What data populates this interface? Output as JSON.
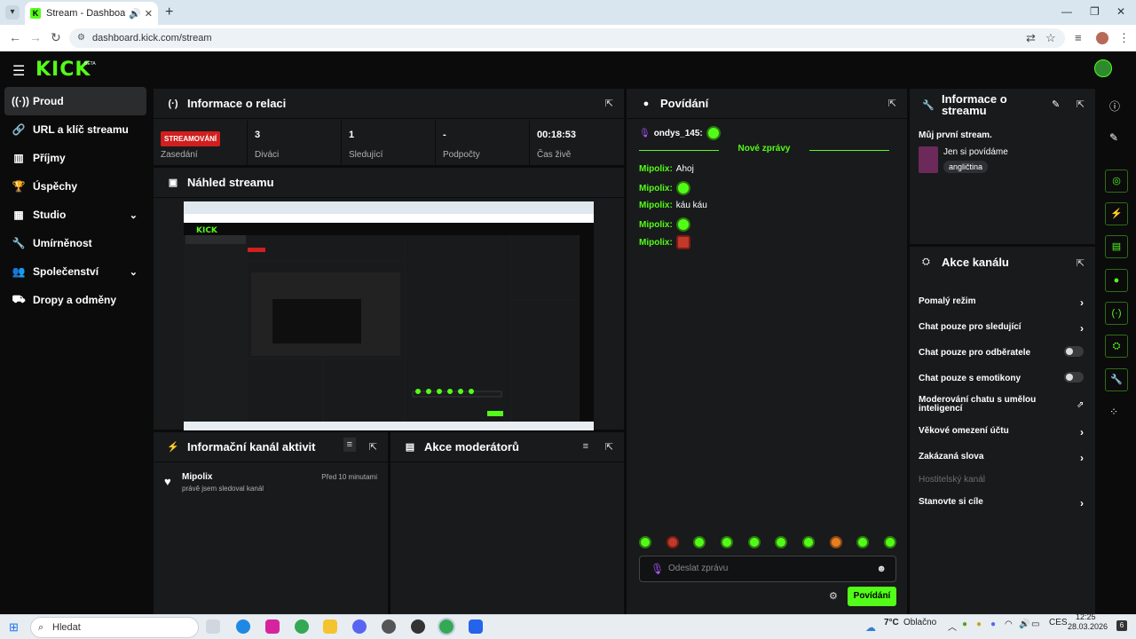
{
  "browser": {
    "tab_title": "Stream - Dashboard Kicku",
    "favicon_letter": "K",
    "url": "dashboard.kick.com/stream"
  },
  "header": {
    "logo": "KICK",
    "logo_badge": "BETA"
  },
  "sidebar": {
    "items": [
      {
        "label": "Proud",
        "icon": "broadcast-icon"
      },
      {
        "label": "URL a klíč streamu",
        "icon": "link-icon"
      },
      {
        "label": "Příjmy",
        "icon": "chart-icon"
      },
      {
        "label": "Úspěchy",
        "icon": "trophy-icon"
      },
      {
        "label": "Studio",
        "icon": "studio-icon"
      },
      {
        "label": "Umírněnost",
        "icon": "wrench-icon"
      },
      {
        "label": "Společenství",
        "icon": "community-icon"
      },
      {
        "label": "Dropy a odměny",
        "icon": "drops-icon"
      }
    ]
  },
  "session": {
    "title": "Informace o relaci",
    "badge": "STREAMOVÁNÍ",
    "badge_label": "Zasedání",
    "stats": [
      {
        "value": "3",
        "label": "Diváci"
      },
      {
        "value": "1",
        "label": "Sledující"
      },
      {
        "value": "-",
        "label": "Podpočty"
      },
      {
        "value": "00:18:53",
        "label": "Čas živě"
      }
    ]
  },
  "preview": {
    "title": "Náhled streamu"
  },
  "activity": {
    "title": "Informační kanál aktivit",
    "items": [
      {
        "user": "Mipolix",
        "time": "Před 10 minutami",
        "text": "právě jsem sledoval kanál"
      }
    ]
  },
  "moderators": {
    "title": "Akce moderátorů"
  },
  "chat": {
    "title": "Povídání",
    "pinned_user": "ondys_145:",
    "new_messages": "Nové zprávy",
    "messages": [
      {
        "user": "Mipolix:",
        "text": "Ahoj"
      },
      {
        "user": "Mipolix:",
        "text": ""
      },
      {
        "user": "Mipolix:",
        "text": "káu káu"
      },
      {
        "user": "Mipolix:",
        "text": ""
      },
      {
        "user": "Mipolix:",
        "text": ""
      }
    ],
    "input_placeholder": "Odeslat zprávu",
    "send_button": "Povídání"
  },
  "stream_info": {
    "title": "Informace o streamu",
    "stream_title": "Můj první stream.",
    "category": "Jen si povídáme",
    "language": "angličtina"
  },
  "channel_actions": {
    "title": "Akce kanálu",
    "items": [
      {
        "label": "Pomalý režim",
        "control": "chevron"
      },
      {
        "label": "Chat pouze pro sledující",
        "control": "chevron"
      },
      {
        "label": "Chat pouze pro odběratele",
        "control": "toggle"
      },
      {
        "label": "Chat pouze s emotikony",
        "control": "toggle"
      },
      {
        "label": "Moderování chatu s umělou inteligencí",
        "control": "external"
      },
      {
        "label": "Věkové omezení účtu",
        "control": "chevron"
      },
      {
        "label": "Zakázaná slova",
        "control": "chevron"
      },
      {
        "label": "Hostitelský kanál",
        "control": "disabled"
      },
      {
        "label": "Stanovte si cíle",
        "control": "chevron"
      }
    ]
  },
  "taskbar": {
    "search_placeholder": "Hledat",
    "weather_temp": "7°C",
    "weather_text": "Oblačno",
    "language": "CES",
    "time": "12:25",
    "date": "28.03.2026",
    "notification_count": "6"
  },
  "colors": {
    "accent": "#53fc18",
    "panel": "#191a1c",
    "background": "#0b0b0c",
    "live": "#d11e1e"
  }
}
